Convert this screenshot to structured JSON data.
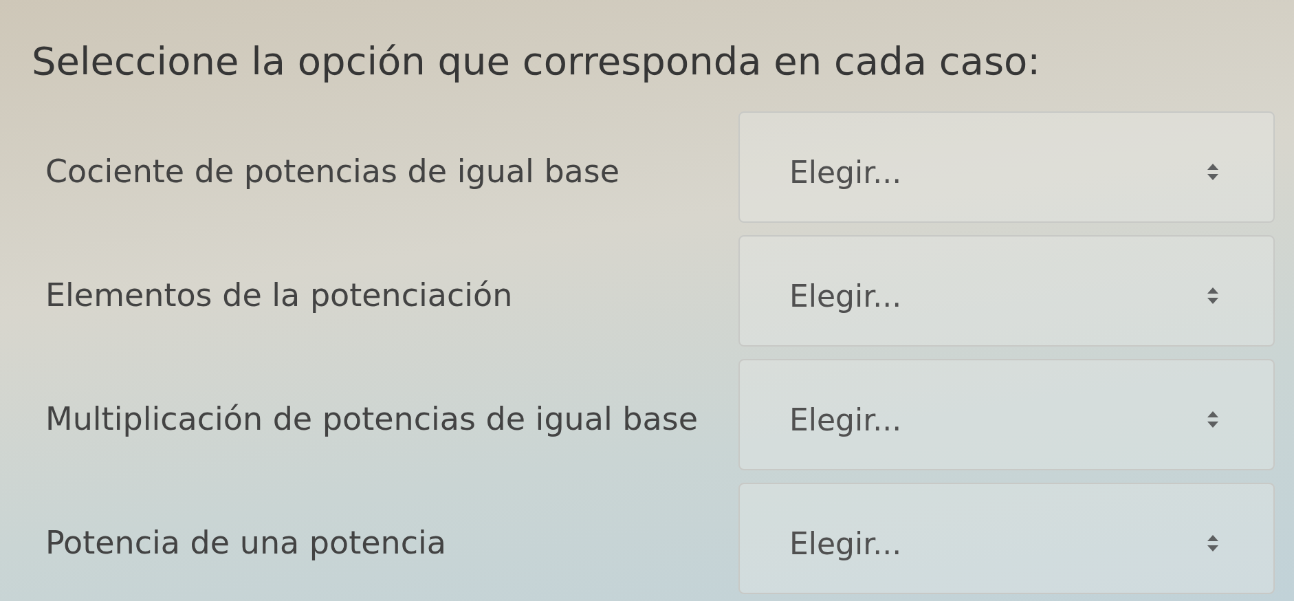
{
  "instruction": "Seleccione la opción que corresponda en cada caso:",
  "questions": [
    {
      "label": "Cociente de potencias de igual base",
      "select": {
        "value": "Elegir..."
      }
    },
    {
      "label": "Elementos de la potenciación",
      "select": {
        "value": "Elegir..."
      }
    },
    {
      "label": "Multiplicación de potencias de igual base",
      "select": {
        "value": "Elegir..."
      }
    },
    {
      "label": "Potencia de una potencia",
      "select": {
        "value": "Elegir..."
      }
    }
  ]
}
